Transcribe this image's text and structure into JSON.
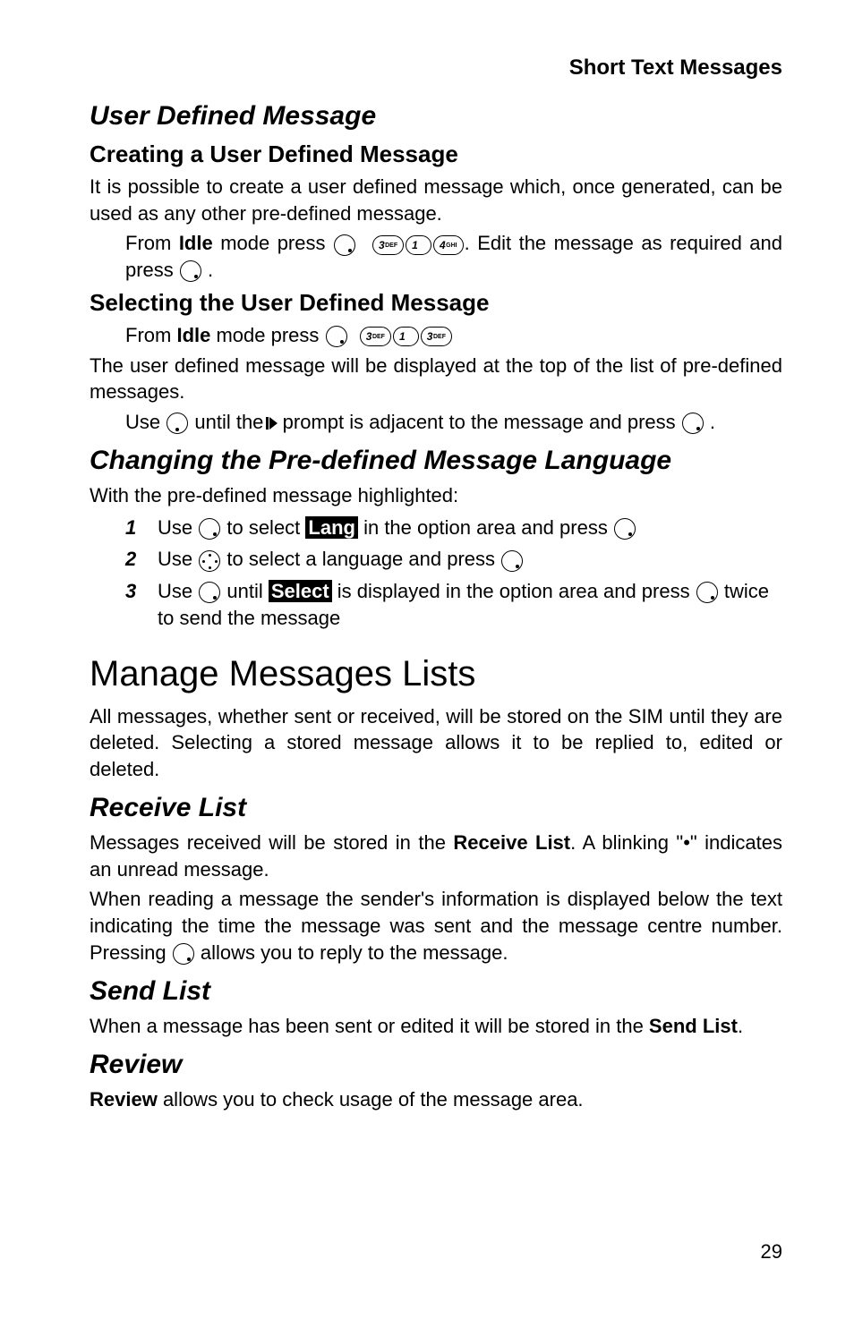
{
  "header": {
    "title": "Short Text Messages"
  },
  "sec1": {
    "title": "User Defined Message",
    "create": {
      "heading": "Creating a User Defined Message",
      "p1": "It is possible to create a user defined message which, once generated, can be used as any other pre-defined message.",
      "from_idle_a": "From ",
      "idle": "Idle",
      "from_idle_b": " mode press ",
      "tail": ". Edit the message as required and press ",
      "dot": " ."
    },
    "select": {
      "heading": "Selecting the User Defined Message",
      "from_idle_a": "From ",
      "idle": "Idle",
      "from_idle_b": " mode press ",
      "p2": "The user defined message will be displayed at the top of the list of pre-defined messages.",
      "use_a": "Use ",
      "use_b": " until the ",
      "use_c": " prompt is adjacent to the message and press ",
      "dot": " ."
    }
  },
  "sec2": {
    "title": "Changing the Pre-defined Message Language",
    "p1": "With the pre-defined message highlighted:",
    "items": [
      {
        "n": "1",
        "a": "Use ",
        "b": " to select ",
        "tag": "Lang",
        "c": " in the option area and press "
      },
      {
        "n": "2",
        "a": "Use ",
        "b": " to select a language and press "
      },
      {
        "n": "3",
        "a": "Use ",
        "b": " until ",
        "tag": "Select",
        "c": " is displayed in the option area and press ",
        "d": " twice to send the message"
      }
    ]
  },
  "sec3": {
    "title": "Manage Messages Lists",
    "p1": "All messages, whether sent or received, will be stored on the SIM until they are deleted. Selecting a stored message allows it to be replied to, edited or deleted.",
    "receive": {
      "title": "Receive List",
      "p1a": "Messages received will be stored in the ",
      "p1b": "Receive List",
      "p1c": ". A blinking \"•\" indicates an unread message.",
      "p2a": "When reading a message the sender's information is displayed below the text indicating the time the message was sent and the message centre number. Pressing ",
      "p2b": " allows you to reply to the message."
    },
    "send": {
      "title": "Send List",
      "p1a": "When a message has been sent or edited it will be stored in the ",
      "p1b": "Send List",
      "p1c": "."
    },
    "review": {
      "title": "Review",
      "p1a": "Review",
      "p1b": " allows you to check usage of the message area."
    }
  },
  "page": "29"
}
